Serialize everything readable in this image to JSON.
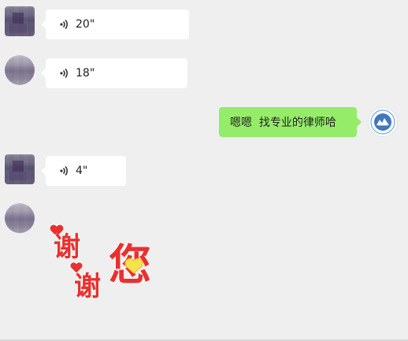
{
  "messages": [
    {
      "type": "voice",
      "duration": "20\""
    },
    {
      "type": "voice",
      "duration": "18\""
    },
    {
      "type": "text",
      "text": "嗯嗯  找专业的律师哈"
    },
    {
      "type": "voice",
      "duration": "4\""
    },
    {
      "type": "sticker",
      "lines": [
        "谢",
        "谢",
        "您"
      ]
    }
  ],
  "colors": {
    "background": "#efefef",
    "incoming_bubble": "#ffffff",
    "outgoing_bubble": "#95ec69",
    "sticker_red": "#e8312f",
    "sticker_yellow": "#f6e24a"
  },
  "icons": {
    "voice": "voice-wave-icon",
    "heart": "heart-icon"
  }
}
